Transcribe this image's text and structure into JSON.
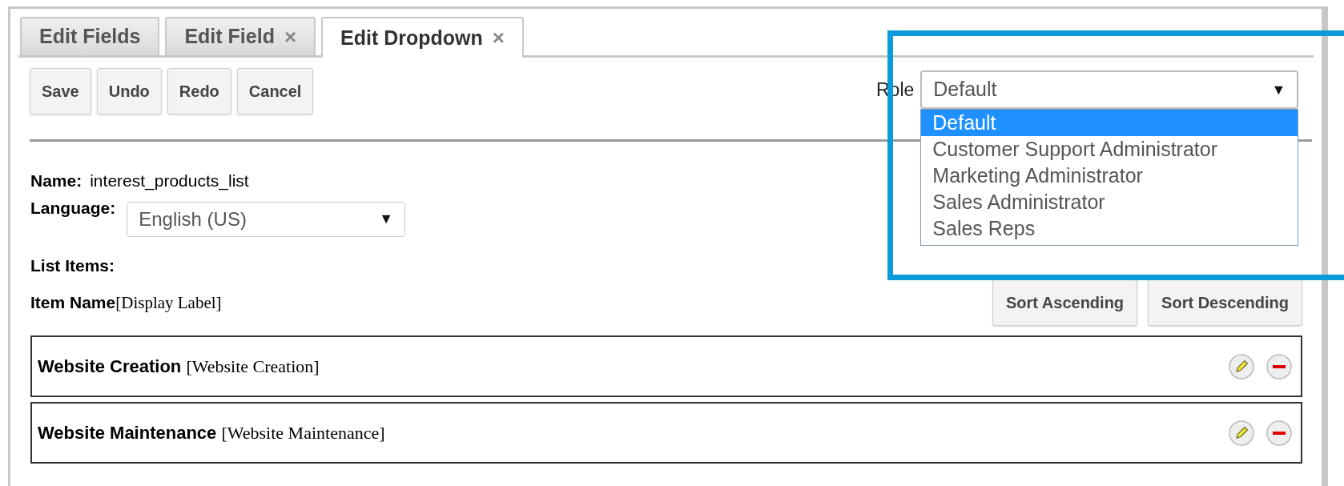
{
  "tabs": [
    {
      "label": "Edit Fields",
      "selected": false
    },
    {
      "label": "Edit Field",
      "selected": false,
      "close": "×"
    },
    {
      "label": "Edit Dropdown",
      "selected": true,
      "close": "×"
    }
  ],
  "toolbar": [
    "Save",
    "Undo",
    "Redo",
    "Cancel"
  ],
  "role": {
    "label": "Role",
    "value": "Default",
    "caret": "▼",
    "expanded": true,
    "options": [
      {
        "label": "Default",
        "selected": true
      },
      {
        "label": "Customer Support Administrator",
        "selected": false
      },
      {
        "label": "Marketing Administrator",
        "selected": false
      },
      {
        "label": "Sales Administrator",
        "selected": false
      },
      {
        "label": "Sales Reps",
        "selected": false
      }
    ]
  },
  "highlight": {
    "shown": true,
    "color": "#0b9bdb"
  },
  "name": {
    "label": "Name:",
    "value": "interest_products_list"
  },
  "language": {
    "label": "Language:",
    "value": "English (US)",
    "caret": "▼"
  },
  "list_items_label": "List Items:",
  "header": {
    "name": "Item Name",
    "display": "[Display Label]"
  },
  "sort_buttons": [
    "Sort Ascending",
    "Sort Descending"
  ],
  "items": [
    {
      "name": "Website Creation",
      "display": "[Website Creation]"
    },
    {
      "name": "Website Maintenance",
      "display": "[Website Maintenance]"
    }
  ]
}
